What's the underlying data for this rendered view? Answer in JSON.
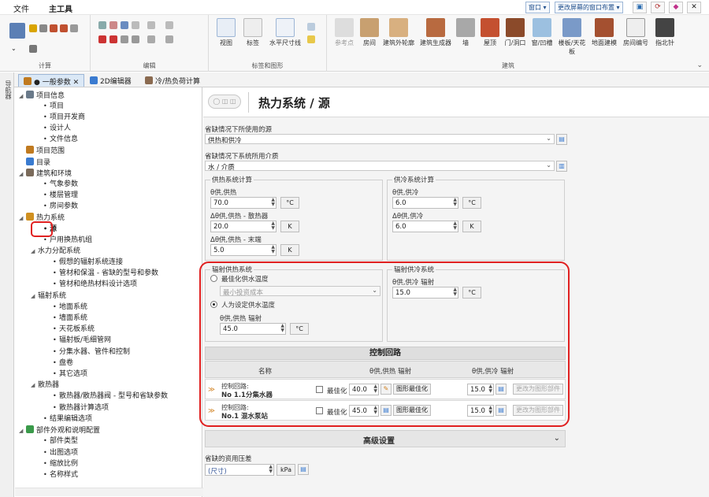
{
  "menubar": {
    "file": "文件",
    "main_tools": "主工具",
    "window_btn": "窗口 ▾",
    "layout_btn": "更改屏幕的窗口布置 ▾"
  },
  "ribbon": {
    "groups": {
      "calc": "计算",
      "edit": "编辑",
      "labels": "标签和图形",
      "build": "建筑"
    },
    "view": "视图",
    "labels_btn": "标签",
    "hdim": "水平尺寸线",
    "build_buttons": [
      "参考点",
      "房间",
      "建筑外轮廓",
      "建筑生成器",
      "墙",
      "屋顶",
      "门/洞口",
      "窗/凹槽",
      "楼板/天花板",
      "地面建模",
      "房间编号",
      "指北针"
    ]
  },
  "sidebar": {
    "label": "导航器"
  },
  "tabs": [
    {
      "label": "● 一般参数"
    },
    {
      "label": "2D编辑器"
    },
    {
      "label": "冷/热负荷计算"
    }
  ],
  "tree": [
    {
      "label": "项目信息"
    },
    {
      "label": "项目"
    },
    {
      "label": "项目开发商"
    },
    {
      "label": "设计人"
    },
    {
      "label": "文件信息"
    },
    {
      "label": "项目范围"
    },
    {
      "label": "目录"
    },
    {
      "label": "建筑和环境"
    },
    {
      "label": "气象参数"
    },
    {
      "label": "楼层管理"
    },
    {
      "label": "房间参数"
    },
    {
      "label": "热力系统"
    },
    {
      "label": "源"
    },
    {
      "label": "户用换热机组"
    },
    {
      "label": "水力分配系统"
    },
    {
      "label": "假想的辐射系统连接"
    },
    {
      "label": "管材和保温 - 省缺的型号和参数"
    },
    {
      "label": "管材和绝热材料设计选项"
    },
    {
      "label": "辐射系统"
    },
    {
      "label": "地面系统"
    },
    {
      "label": "墙面系统"
    },
    {
      "label": "天花板系统"
    },
    {
      "label": "辐射板/毛细管网"
    },
    {
      "label": "分集水器、管件和控制"
    },
    {
      "label": "盘卷"
    },
    {
      "label": "其它选项"
    },
    {
      "label": "散热器"
    },
    {
      "label": "散热器/散热器阀 - 型号和省缺参数"
    },
    {
      "label": "散热器计算选项"
    },
    {
      "label": "结果编辑选项"
    },
    {
      "label": "部件外观和说明配置"
    },
    {
      "label": "部件类型"
    },
    {
      "label": "出图选项"
    },
    {
      "label": "缩放比例"
    },
    {
      "label": "名称样式"
    }
  ],
  "header": {
    "back": "◯ ◫ ◫",
    "title": "热力系统 / 源"
  },
  "form": {
    "source_label": "省缺情况下所使用的源",
    "source_value": "供热和供冷",
    "medium_label": "省缺情况下系统所用介质",
    "medium_value": "水 / 介质",
    "heating_calc": {
      "title": "供热系统计算",
      "t_supply_label": "θ供,供热",
      "t_supply": "70.0",
      "unit_c": "°C",
      "dt_rad_label": "Δθ供,供热 - 散热器",
      "dt_rad": "20.0",
      "unit_k": "K",
      "dt_floor_label": "Δθ供,供热 - 末端",
      "dt_floor": "5.0"
    },
    "cooling_calc": {
      "title": "供冷系统计算",
      "t_supply_label": "θ供,供冷",
      "t_supply": "6.0",
      "dt_label": "Δθ供,供冷",
      "dt": "6.0"
    },
    "rad_heat": {
      "title": "辐射供热系统",
      "opt_best": "最佳化供水温度",
      "min_cost": "最小投资成本",
      "opt_manual": "人为设定供水温度",
      "t_label": "θ供,供热 辐射",
      "t_value": "45.0"
    },
    "rad_cool": {
      "title": "辐射供冷系统",
      "t_label": "θ供,供冷 辐射",
      "t_value": "15.0"
    },
    "control": {
      "title": "控制回路",
      "col_name": "名称",
      "col_heat": "θ供,供热 辐射",
      "col_cool": "θ供,供冷 辐射",
      "rows": [
        {
          "prefix": "控制回路:",
          "name": "No 1.1分集水器",
          "opt": "最佳化",
          "heat": "40.0",
          "optbtn": "图形最佳化",
          "cool": "15.0",
          "change": "更改为图形部件"
        },
        {
          "prefix": "控制回路:",
          "name": "No.1 混水泵站",
          "opt": "最佳化",
          "heat": "45.0",
          "optbtn": "图形最佳化",
          "cool": "15.0",
          "change": "更改为图形部件"
        }
      ]
    },
    "advanced": "高级设置",
    "pressure_label": "省缺的资用压差",
    "pressure_value": "(尺寸)",
    "pressure_unit": "kPa"
  }
}
